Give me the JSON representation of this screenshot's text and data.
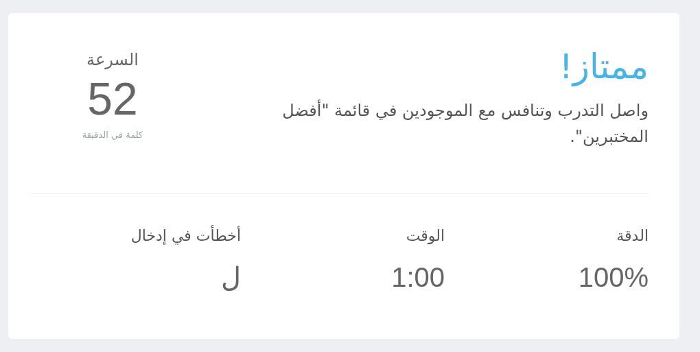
{
  "result": {
    "title": "ممتاز!",
    "message": "واصل التدرب وتنافس مع الموجودين في قائمة \"أفضل المختبرين\"."
  },
  "speed": {
    "label": "السرعة",
    "value": "52",
    "unit": "كلمة في الدقيقة"
  },
  "stats": [
    {
      "label": "الدقة",
      "value": "100%"
    },
    {
      "label": "الوقت",
      "value": "1:00"
    },
    {
      "label": "أخطأت في إدخال",
      "value": "ل"
    }
  ]
}
